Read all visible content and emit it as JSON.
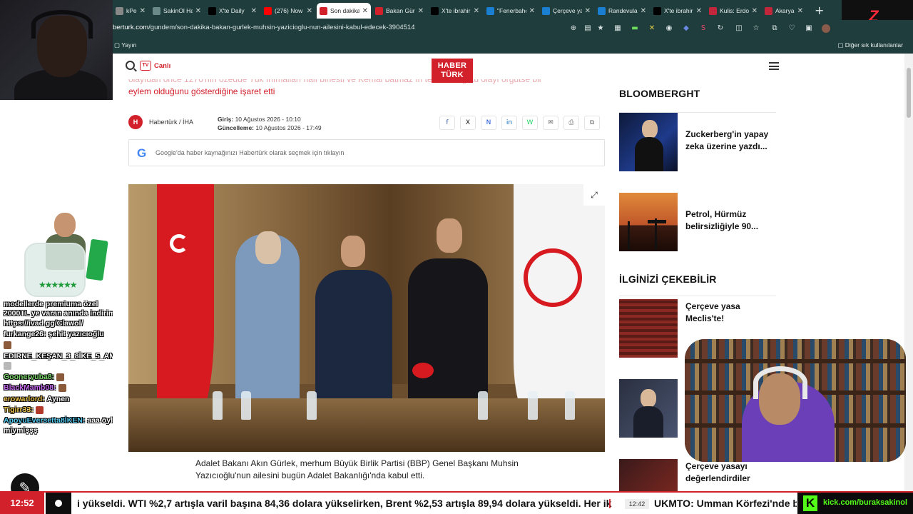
{
  "browser": {
    "tabs": [
      {
        "label": "kPeek -",
        "icon": "tab-favicon",
        "color": "#888888"
      },
      {
        "label": "SakinOl Ha",
        "icon": "globe-icon",
        "color": "#6a8a8a"
      },
      {
        "label": "X'te Daily",
        "icon": "x-icon",
        "color": "#000000"
      },
      {
        "label": "(276) Now",
        "icon": "youtube-icon",
        "color": "#ff0000"
      },
      {
        "label": "Son dakika",
        "icon": "haberturk-icon",
        "color": "#d3212c",
        "active": true
      },
      {
        "label": "Bakan Gürl",
        "icon": "bookmark-icon",
        "color": "#d3212c"
      },
      {
        "label": "X'te ibrahir",
        "icon": "x-icon",
        "color": "#000000"
      },
      {
        "label": "\"Fenerbahç",
        "icon": "tab-favicon",
        "color": "#1a7fd1"
      },
      {
        "label": "Çerçeve ya",
        "icon": "tab-favicon",
        "color": "#1a7fd1"
      },
      {
        "label": "Randevula",
        "icon": "tab-favicon",
        "color": "#1a7fd1"
      },
      {
        "label": "X'te ibrahir",
        "icon": "x-icon",
        "color": "#000000"
      },
      {
        "label": "Kulis: Erdo",
        "icon": "b-icon",
        "color": "#c2263a"
      },
      {
        "label": "Akaryakıta",
        "icon": "b-icon",
        "color": "#c2263a"
      }
    ],
    "new_tab": "+",
    "url_domain": "berturk.com",
    "url_path": "/gundem/son-dakika-bakan-gurlek-muhsin-yazicioglu-nun-ailesini-kabul-edecek-3904514",
    "bookmark_item": "Yayın",
    "bookmark_other": "Diğer sık kullanılanlar"
  },
  "overlay": {
    "streamer_logo": "Z",
    "chat": [
      {
        "user": "",
        "text": "modellerde premiuma özel 2000TL ye varan anında indirim https://ivad.gg/Clawol/",
        "color": "#ffffff"
      },
      {
        "user": "furkange26:",
        "text": "şehit yazıcıoğlu",
        "color": "#ffffff"
      },
      {
        "user": "",
        "text": "",
        "color": "#ffffff",
        "emote": true
      },
      {
        "user": "EDIRNE_KEŞAN_3_8İKE_5_AM:",
        "text": "",
        "color": "#ffffff",
        "emote": true
      },
      {
        "user": "Gooneryuba8:",
        "text": "",
        "color": "#7cd96b",
        "emote": true
      },
      {
        "user": "BlackMamb08:",
        "text": "",
        "color": "#c56cf0",
        "emote": true
      },
      {
        "user": "erowarlord:",
        "text": "Aynen",
        "color": "#f2c94c"
      },
      {
        "user": "Tigirr33:",
        "text": "",
        "color": "#f2c94c",
        "emote": true
      },
      {
        "user": "ApoyuEversetta8İKEN:",
        "text": "aaa öyle miymişşş",
        "color": "#56ccf2"
      }
    ]
  },
  "site": {
    "live_badge": "TV",
    "live_label": "Canlı",
    "logo_line1": "HABER",
    "logo_line2": "TÜRK",
    "spot_faded": "olayıdan önce 1276'nın özedde Tük İnımalları halı birlesti ve Kemal batmaz ın",
    "spot_faded_2": "terörün örgütü olayı örgütse bir",
    "spot_line": "eylem olduğunu gösterdiğine işaret etti",
    "source_logo": "H",
    "source": "Habertürk / İHA",
    "published_label": "Giriş:",
    "published": "10 Ağustos 2026 - 10:10",
    "updated_label": "Güncelleme:",
    "updated": "10 Ağustos 2026 - 17:49",
    "share": [
      "f",
      "X",
      "N",
      "in",
      "W",
      "✉",
      "⎙",
      "⧉"
    ],
    "google_g": "G",
    "google_prompt": "Google'da haber kaynağınızı Habertürk olarak seçmek için tıklayın",
    "expand": "⤢",
    "paragraph": "Adalet Bakanı Akın Gürlek, merhum Büyük Birlik Partisi (BBP) Genel Başkanı Muhsin Yazıcıoğlu'nun ailesini bugün Adalet Bakanlığı'nda kabul etti."
  },
  "sidebar": {
    "section1": "BLOOMBERGHT",
    "section2": "İLGİNİZİ ÇEKEBİLİR",
    "cards": [
      {
        "title": "Zuckerberg'in yapay zeka üzerine yazdı..."
      },
      {
        "title": "Petrol, Hürmüz belirsizliğiyle 90..."
      },
      {
        "title": "Çerçeve yasa Meclis'te!"
      },
      {
        "title": ""
      },
      {
        "title": "Çerçeve yasayı değerlendirdiler"
      }
    ]
  },
  "ticker": {
    "time": "12:52",
    "text": "i yükseldi. WTI %2,7 artışla varil başına 84,36 dolara yükselirken, Brent %2,53 artışla 89,94 dolara yükseldi. Her ik",
    "sep": "|",
    "time2": "12:42",
    "text2": "UKMTO: Umman Körfezi'nde b",
    "kick_logo": "K",
    "kick_url": "kick.com/buraksakinol"
  }
}
